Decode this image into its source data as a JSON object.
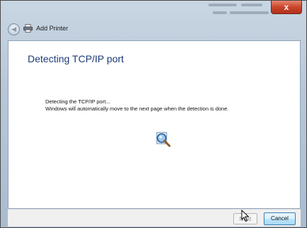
{
  "window": {
    "title": "Add Printer",
    "close_label": "x"
  },
  "content": {
    "heading": "Detecting TCP/IP port",
    "line1": "Detecting the TCP/IP port...",
    "line2": "Windows will automatically move to the next page when the detection is done."
  },
  "footer": {
    "next_label": "Next",
    "cancel_label": "Cancel"
  },
  "icons": {
    "back": "back-arrow-icon",
    "printer": "printer-icon",
    "search": "magnifier-search-icon",
    "cursor": "mouse-pointer-icon"
  },
  "colors": {
    "heading": "#1c3a78",
    "close_button": "#c9452b",
    "cancel_border": "#3c7fb1"
  }
}
